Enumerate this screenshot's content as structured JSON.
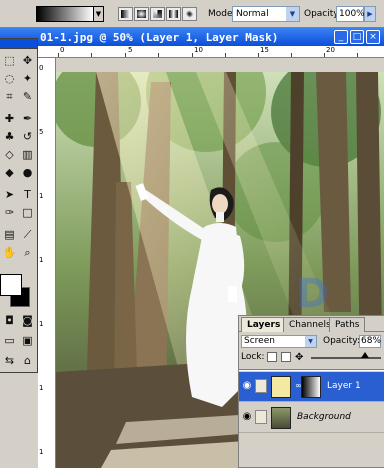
{
  "options_bar": {
    "mode_label": "Mode:",
    "mode_value": "Normal",
    "opacity_label": "Opacity:",
    "opacity_value": "100%"
  },
  "document": {
    "title": "01-1.jpg @ 50% (Layer 1, Layer Mask)",
    "ruler_top_ticks": [
      "0",
      "5",
      "10",
      "15",
      "20"
    ],
    "ruler_left_ticks": [
      "0",
      "5",
      "1",
      "1",
      "1",
      "1",
      "1"
    ]
  },
  "layers_panel": {
    "tabs": [
      "Layers",
      "Channels",
      "Paths"
    ],
    "blend_mode": "Screen",
    "opacity_label": "Opacity:",
    "opacity_value": "68%",
    "lock_label": "Lock:",
    "layers": [
      {
        "name": "Layer 1",
        "selected": true
      },
      {
        "name": "Background",
        "selected": false
      }
    ]
  },
  "colors": {
    "title_bar": "#0a4fd8",
    "selected_layer": "#2a5fd1",
    "panel_bg": "#d4d0c8"
  }
}
